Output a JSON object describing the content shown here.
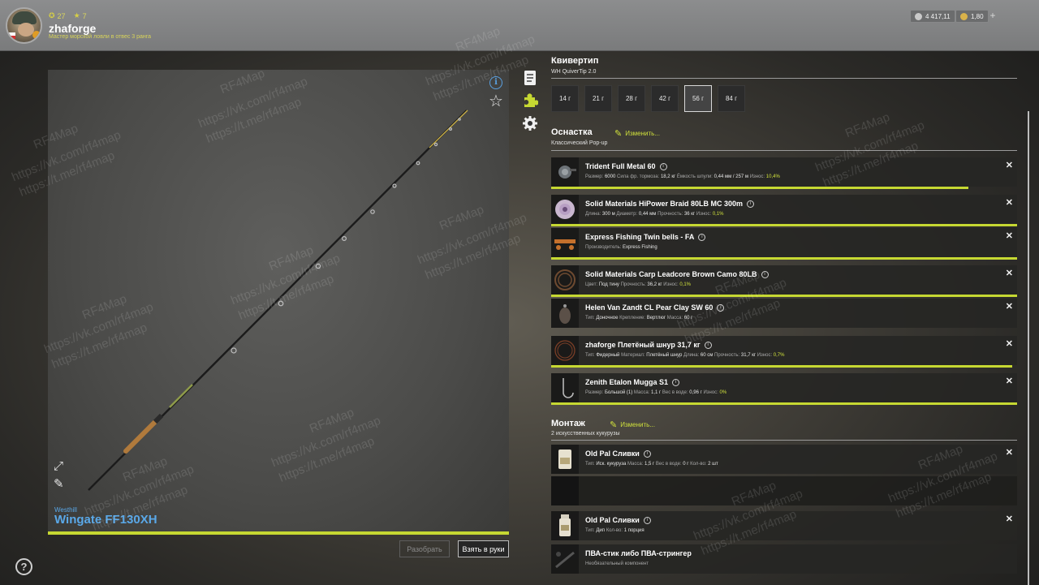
{
  "header": {
    "level": "27",
    "rank": "7",
    "username": "zhaforge",
    "title": "Мастер морской ловли в отвес 3 ранга",
    "silver": "4 417,11",
    "gold": "1,80",
    "plus": "+"
  },
  "preview": {
    "brand": "Westhill",
    "rod_name": "Wingate FF130XH",
    "disassemble_label": "Разобрать",
    "take_label": "Взять в руки",
    "help": "?"
  },
  "quivertip": {
    "title": "Квивертип",
    "subtitle": "WH QuiverTip 2.0",
    "options": [
      "14 г",
      "21 г",
      "28 г",
      "42 г",
      "56 г",
      "84 г"
    ],
    "selected": "56 г"
  },
  "tackle": {
    "title": "Оснастка",
    "edit_label": "Изменить...",
    "subtitle": "Классический Pop-up",
    "items": [
      {
        "name": "Trident Full Metal 60",
        "details": [
          {
            "label": "Размер:",
            "value": "6000"
          },
          {
            "label": "Сила фр. тормоза:",
            "value": "18,2 кг"
          },
          {
            "label": "Ёмкость шпули:",
            "value": "0,44 мм / 257 м"
          },
          {
            "label": "Износ:",
            "value": "10,4%",
            "highlight": true
          }
        ]
      },
      {
        "name": "Solid Materials HiPower Braid 80LB MC 300m",
        "details": [
          {
            "label": "Длина:",
            "value": "300 м"
          },
          {
            "label": "Диаметр:",
            "value": "0,44 мм"
          },
          {
            "label": "Прочность:",
            "value": "36 кг"
          },
          {
            "label": "Износ:",
            "value": "0,1%",
            "highlight": true
          }
        ]
      },
      {
        "name": "Express Fishing Twin bells - FA",
        "details": [
          {
            "label": "Производитель:",
            "value": "Express Fishing"
          }
        ]
      },
      {
        "name": "Solid Materials Carp Leadcore Brown Camo 80LB",
        "details": [
          {
            "label": "Цвет:",
            "value": "Под тину"
          },
          {
            "label": "Прочность:",
            "value": "36,2 кг"
          },
          {
            "label": "Износ:",
            "value": "0,1%",
            "highlight": true
          }
        ]
      },
      {
        "name": "Helen Van Zandt CL Pear Clay SW 60",
        "details": [
          {
            "label": "Тип:",
            "value": "Доночное"
          },
          {
            "label": "Крепление:",
            "value": "Вертлюг"
          },
          {
            "label": "Масса:",
            "value": "60 г"
          }
        ]
      },
      {
        "name": "zhaforge Плетёный шнур 31,7 кг",
        "details": [
          {
            "label": "Тип:",
            "value": "Фидерный"
          },
          {
            "label": "Материал:",
            "value": "Плетёный шнур"
          },
          {
            "label": "Длина:",
            "value": "60 см"
          },
          {
            "label": "Прочность:",
            "value": "31,7 кг"
          },
          {
            "label": "Износ:",
            "value": "0,7%",
            "highlight": true
          }
        ]
      },
      {
        "name": "Zenith Etalon Mugga S1",
        "details": [
          {
            "label": "Размер:",
            "value": "Большой (1)"
          },
          {
            "label": "Масса:",
            "value": "1,1 г"
          },
          {
            "label": "Вес в воде:",
            "value": "0,96 г"
          },
          {
            "label": "Износ:",
            "value": "0%",
            "highlight": true
          }
        ]
      }
    ],
    "wear_fraction": [
      0.896,
      1,
      1,
      1,
      null,
      0.99,
      1
    ]
  },
  "montage": {
    "title": "Монтаж",
    "edit_label": "Изменить...",
    "subtitle": "2 искусственных кукурузы",
    "items": [
      {
        "name": "Old Pal Сливки",
        "details": [
          {
            "label": "Тип:",
            "value": "Иск. кукуруза"
          },
          {
            "label": "Масса:",
            "value": "1,5 г"
          },
          {
            "label": "Вес в воде:",
            "value": "0 г"
          },
          {
            "label": "Кол-во:",
            "value": "2 шт"
          }
        ]
      },
      {
        "name": "Old Pal Сливки",
        "details": [
          {
            "label": "Тип:",
            "value": "Дип"
          },
          {
            "label": "Кол-во:",
            "value": "1 порция"
          }
        ]
      },
      {
        "name": "ПВА-стик либо ПВА-стрингер",
        "details": [
          {
            "label": "Необязательный компонент",
            "value": ""
          }
        ]
      }
    ]
  },
  "watermarks": [
    "RF4Map",
    "https://vk.com/rf4map",
    "https://t.me/rf4map"
  ],
  "colors": {
    "accent": "#c6d832",
    "rod_name": "#5aa8e8",
    "header_bg": "#858687"
  },
  "icons": [
    "star-icon",
    "info-icon",
    "expand-icon",
    "pencil-icon",
    "document-icon",
    "puzzle-icon",
    "gear-icon",
    "help-icon",
    "close-icon",
    "edit-icon",
    "silver-coin-icon",
    "gold-coin-icon"
  ]
}
